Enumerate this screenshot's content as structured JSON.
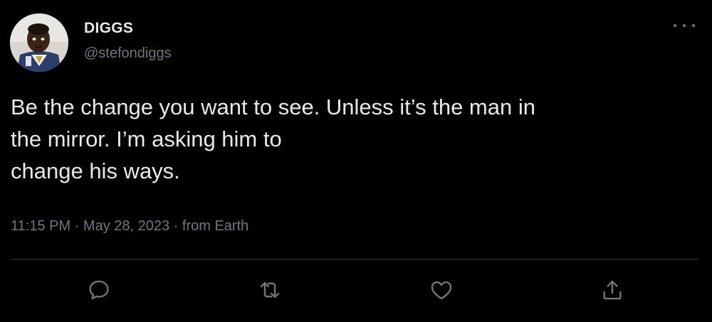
{
  "author": {
    "display_name": "DIGGS",
    "handle": "@stefondiggs"
  },
  "tweet": {
    "lines": [
      "Be the change you want to see. Unless it’s the man in",
      "the mirror. I’m asking him to",
      "change his ways."
    ]
  },
  "meta": {
    "time": "11:15 PM",
    "date": "May 28, 2023",
    "source": "from Earth",
    "separator": " · "
  },
  "actions": [
    {
      "name": "reply",
      "icon": "reply-icon"
    },
    {
      "name": "retweet",
      "icon": "retweet-icon"
    },
    {
      "name": "like",
      "icon": "heart-icon"
    },
    {
      "name": "share",
      "icon": "share-icon"
    }
  ],
  "colors": {
    "background": "#000000",
    "primary_text": "#e7e9ea",
    "secondary_text": "#71767b",
    "divider": "#2f3336"
  }
}
